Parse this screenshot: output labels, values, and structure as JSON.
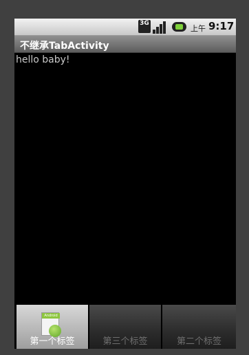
{
  "status_bar": {
    "network_label": "3G",
    "signal_icon": "signal-bars-icon",
    "battery_icon": "battery-charging-icon",
    "ampm": "上午",
    "time": "9:17"
  },
  "title_bar": {
    "title": "不继承TabActivity"
  },
  "content": {
    "text": "hello baby!"
  },
  "tabs": [
    {
      "label": "第一个标签",
      "selected": true,
      "icon": "android-app-icon"
    },
    {
      "label": "第三个标签",
      "selected": false
    },
    {
      "label": "第二个标签",
      "selected": false
    }
  ]
}
